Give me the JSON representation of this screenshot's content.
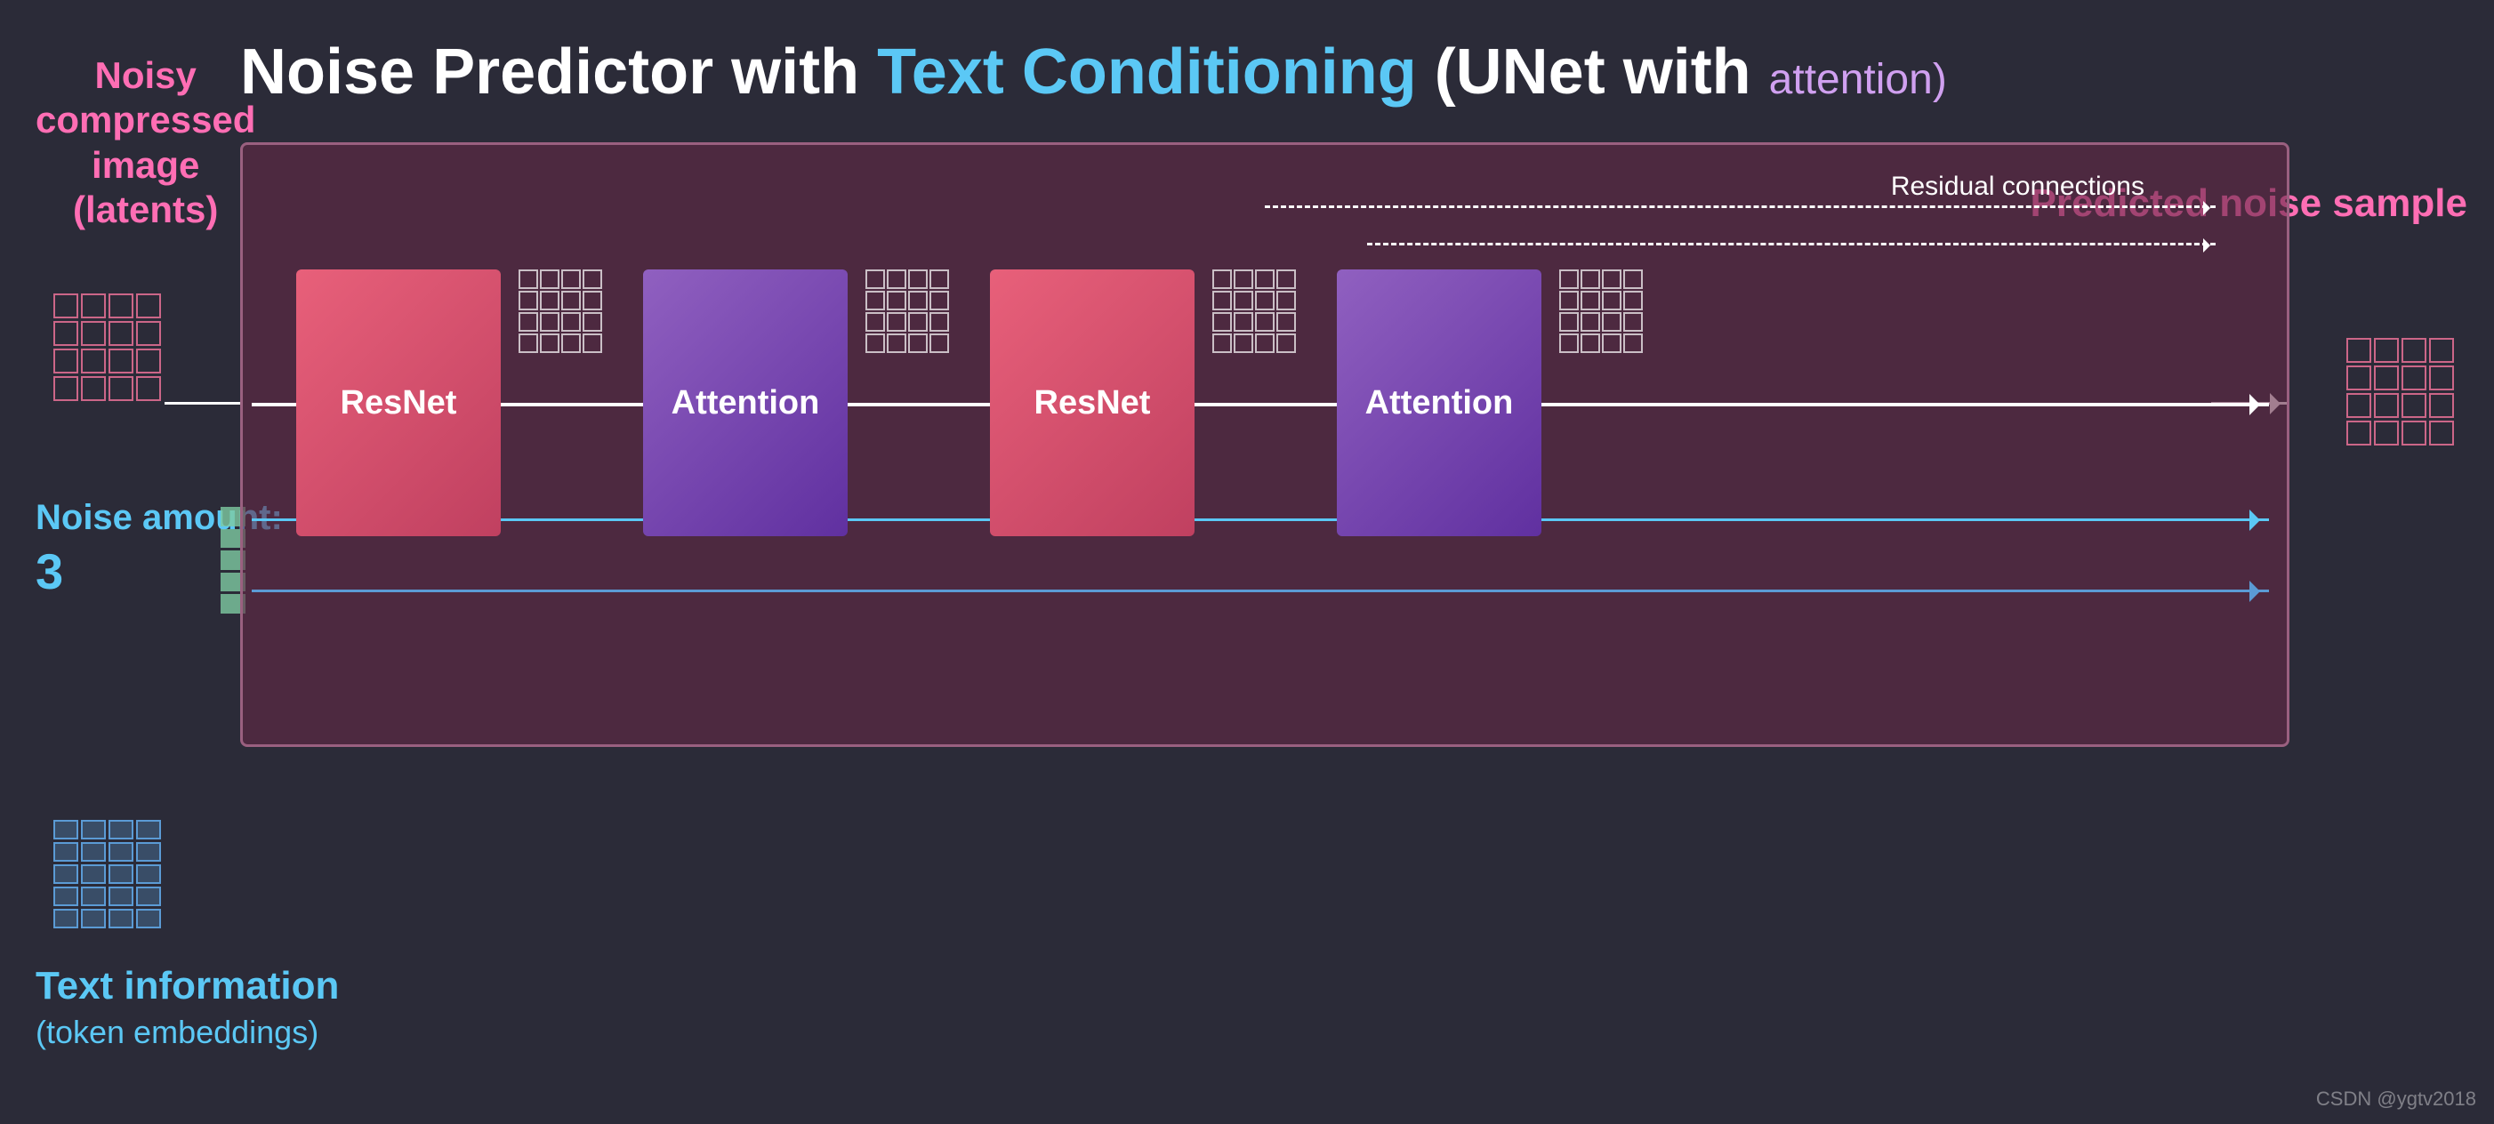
{
  "title": {
    "prefix": "Noise Predictor with ",
    "highlight": "Text Conditioning",
    "suffix": " (UNet with ",
    "attention": "attention",
    "close": ")"
  },
  "labels": {
    "noisy_image": "Noisy\ncompressed\nimage\n(latents)",
    "noise_amount": "Noise amount:",
    "noise_number": "3",
    "text_information": "Text information",
    "token_embeddings": "(token embeddings)",
    "predicted_noise": "Predicted\nnoise sample",
    "residual_connections": "Residual connections"
  },
  "blocks": {
    "resnet1": "ResNet",
    "attention1": "Attention",
    "resnet2": "ResNet",
    "attention2": "Attention"
  },
  "colors": {
    "background": "#2b2b38",
    "pink": "#ff6eb4",
    "cyan": "#5bc8f5",
    "purple": "#d0a0f0",
    "diagram_bg": "rgba(100,40,70,0.6)",
    "resnet": "#e0506a",
    "attention": "#8050b0",
    "blue": "#5b9bd5",
    "teal": "#7ecba1"
  },
  "watermark": "CSDN @ygtv2018"
}
